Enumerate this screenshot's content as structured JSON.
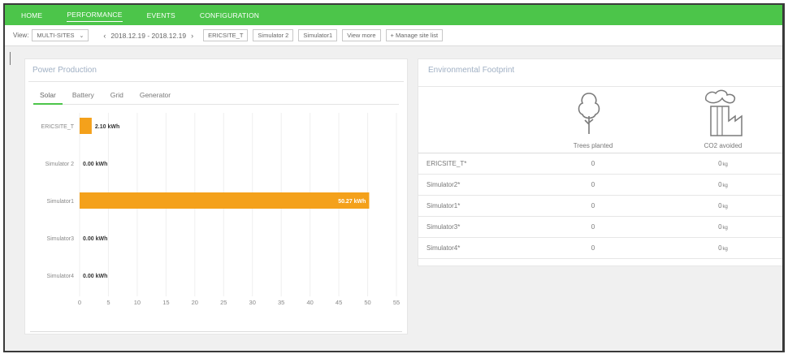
{
  "nav": {
    "items": [
      {
        "label": "HOME",
        "active": false
      },
      {
        "label": "PERFORMANCE",
        "active": true
      },
      {
        "label": "EVENTS",
        "active": false
      },
      {
        "label": "CONFIGURATION",
        "active": false
      }
    ]
  },
  "toolbar": {
    "view_label": "View:",
    "view_select": "MULTI-SITES",
    "date_range": "2018.12.19 - 2018.12.19",
    "prev_icon": "chevron-left-icon",
    "next_icon": "chevron-right-icon",
    "site_buttons": [
      "ERICSITE_T",
      "Simulator 2",
      "Simulator1"
    ],
    "view_more": "View more",
    "manage": "+ Manage site list"
  },
  "power": {
    "title": "Power Production",
    "tabs": [
      {
        "label": "Solar",
        "active": true
      },
      {
        "label": "Battery",
        "active": false
      },
      {
        "label": "Grid",
        "active": false
      },
      {
        "label": "Generator",
        "active": false
      }
    ]
  },
  "chart_data": {
    "type": "bar",
    "orientation": "horizontal",
    "categories": [
      "ERICSITE_T",
      "Simulator 2",
      "Simulator1",
      "Simulator3",
      "Simulator4"
    ],
    "values": [
      2.1,
      0.0,
      50.27,
      0.0,
      0.0
    ],
    "value_labels": [
      "2.10 kWh",
      "0.00 kWh",
      "50.27 kWh",
      "0.00 kWh",
      "0.00 kWh"
    ],
    "x_ticks": [
      0,
      5,
      10,
      15,
      20,
      25,
      30,
      35,
      40,
      45,
      50,
      55
    ],
    "xlim": [
      0,
      55
    ],
    "bar_color": "#f4a11b",
    "grid": true
  },
  "environment": {
    "title": "Environmental Footprint",
    "tree_icon": "tree-icon",
    "factory_icon": "factory-icon",
    "columns": [
      "Trees planted",
      "CO2 avoided"
    ],
    "rows": [
      {
        "site": "ERICSITE_T*",
        "trees": "0",
        "co2": "0",
        "unit": "kg"
      },
      {
        "site": "Simulator2*",
        "trees": "0",
        "co2": "0",
        "unit": "kg"
      },
      {
        "site": "Simulator1*",
        "trees": "0",
        "co2": "0",
        "unit": "kg"
      },
      {
        "site": "Simulator3*",
        "trees": "0",
        "co2": "0",
        "unit": "kg"
      },
      {
        "site": "Simulator4*",
        "trees": "0",
        "co2": "0",
        "unit": "kg"
      }
    ]
  }
}
